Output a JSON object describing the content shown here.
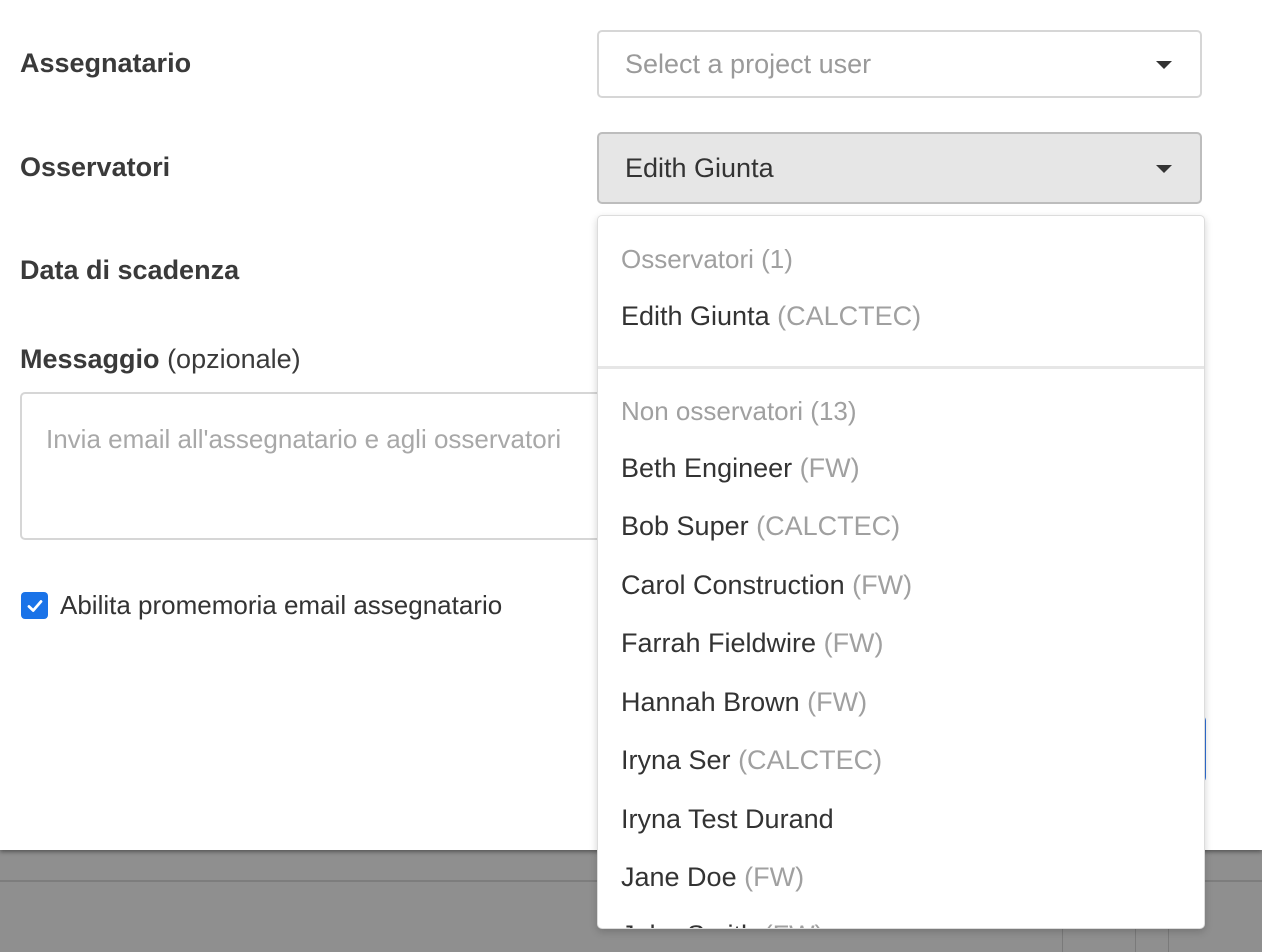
{
  "form": {
    "assignee_label": "Assegnatario",
    "assignee_placeholder": "Select a project user",
    "observers_label": "Osservatori",
    "observers_value": "Edith Giunta",
    "due_date_label": "Data di scadenza",
    "message_label": "Messaggio",
    "message_optional": "(opzionale)",
    "message_placeholder": "Invia email all'assegnatario e agli osservatori",
    "reminder_label": "Abilita promemoria email assegnatario",
    "reminder_checked": true
  },
  "dropdown": {
    "selected_header": "Osservatori (1)",
    "selected": [
      {
        "name": "Edith Giunta",
        "org": "(CALCTEC)"
      }
    ],
    "others_header": "Non osservatori (13)",
    "others": [
      {
        "name": "Beth Engineer",
        "org": "(FW)"
      },
      {
        "name": "Bob Super",
        "org": "(CALCTEC)"
      },
      {
        "name": "Carol Construction",
        "org": "(FW)"
      },
      {
        "name": "Farrah Fieldwire",
        "org": "(FW)"
      },
      {
        "name": "Hannah Brown",
        "org": "(FW)"
      },
      {
        "name": "Iryna Ser",
        "org": "(CALCTEC)"
      },
      {
        "name": "Iryna Test Durand",
        "org": ""
      },
      {
        "name": "Jane Doe",
        "org": "(FW)"
      },
      {
        "name": "John Smith",
        "org": "(FW)"
      }
    ]
  },
  "colors": {
    "checkbox": "#1a73e8",
    "primary_button_border": "#2f6fd6"
  }
}
